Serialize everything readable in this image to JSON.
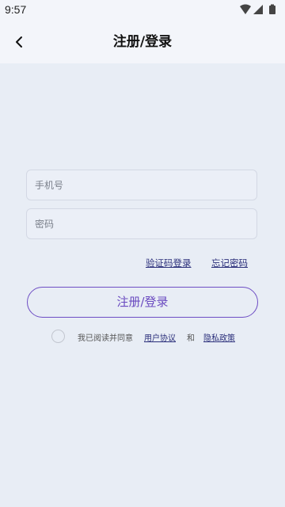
{
  "status_bar": {
    "time": "9:57",
    "icons": [
      "wifi-icon",
      "signal-icon",
      "battery-icon"
    ]
  },
  "app_bar": {
    "back_icon": "chevron-left-icon",
    "title": "注册/登录"
  },
  "form": {
    "phone_placeholder": "手机号",
    "phone_value": "",
    "password_placeholder": "密码",
    "password_value": "",
    "code_login_label": "验证码登录",
    "forgot_password_label": "忘记密码",
    "submit_label": "注册/登录"
  },
  "agreement": {
    "checked": false,
    "prefix": "我已阅读并同意",
    "user_agreement": "用户协议",
    "and": "和",
    "privacy_policy": "隐私政策"
  },
  "colors": {
    "background": "#e8edf5",
    "accent": "#6a4ac0",
    "link": "#2a2e7a"
  }
}
